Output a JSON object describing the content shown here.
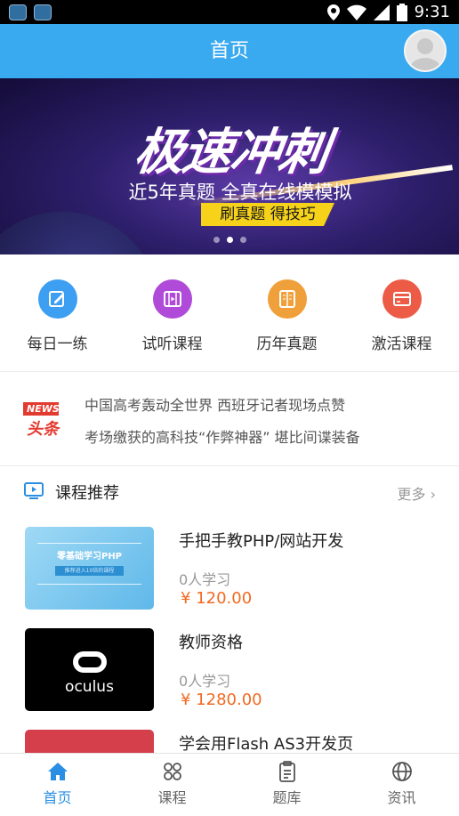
{
  "status_bar": {
    "time": "9:31"
  },
  "header": {
    "title": "首页"
  },
  "banner": {
    "headline": "极速冲刺",
    "subtitle": "近5年真题  全真在线模模拟",
    "ribbon": "刷真题 得技巧"
  },
  "quick_menu": [
    {
      "label": "每日一练",
      "icon": "pencil-note-icon",
      "color": "#3d9ff2"
    },
    {
      "label": "试听课程",
      "icon": "film-icon",
      "color": "#b04ad8"
    },
    {
      "label": "历年真题",
      "icon": "book-icon",
      "color": "#f0a03a"
    },
    {
      "label": "激活课程",
      "icon": "card-icon",
      "color": "#ec5b45"
    }
  ],
  "news": {
    "badge": "NEWS",
    "badge_sub": "头条",
    "lines": [
      "中国高考轰动全世界 西班牙记者现场点赞",
      "考场缴获的高科技“作弊神器” 堪比间谍装备"
    ]
  },
  "section": {
    "title": "课程推荐",
    "more": "更多"
  },
  "courses": [
    {
      "title": "手把手教PHP/网站开发",
      "learners": "0人学习",
      "price": "¥ 120.00",
      "thumb_text": "零基础学习PHP",
      "thumb_sub": "推荐进入10倍的课程"
    },
    {
      "title": "教师资格",
      "learners": "0人学习",
      "price": "¥ 1280.00",
      "thumb_text": "oculus"
    },
    {
      "title": "学会用Flash AS3开发页",
      "learners": "",
      "price": ""
    }
  ],
  "tabs": [
    {
      "label": "首页",
      "icon": "home-icon",
      "active": true
    },
    {
      "label": "课程",
      "icon": "course-icon",
      "active": false
    },
    {
      "label": "题库",
      "icon": "clipboard-icon",
      "active": false
    },
    {
      "label": "资讯",
      "icon": "globe-icon",
      "active": false
    }
  ]
}
